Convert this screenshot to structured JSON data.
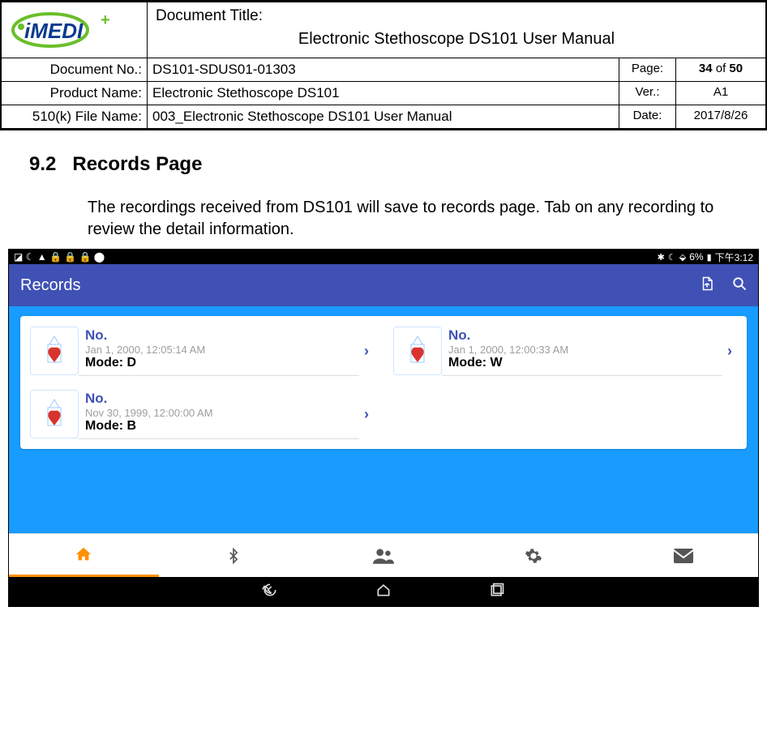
{
  "header": {
    "docTitleLabel": "Document Title:",
    "docTitle": "Electronic Stethoscope DS101 User Manual",
    "docNoLabel": "Document No.:",
    "docNo": "DS101-SDUS01-01303",
    "pageLabel": "Page:",
    "pageCurrent": "34",
    "pageOf": " of ",
    "pageTotal": "50",
    "productLabel": "Product Name:",
    "productName": "Electronic Stethoscope DS101",
    "verLabel": "Ver.:",
    "ver": "A1",
    "fileLabel": "510(k) File Name:",
    "fileName": "003_Electronic Stethoscope DS101 User Manual",
    "dateLabel": "Date:",
    "date": "2017/8/26"
  },
  "section": {
    "number": "9.2",
    "title": "Records Page",
    "body": "The recordings received from DS101 will save to records page. Tab on any recording to review the detail information."
  },
  "screenshot": {
    "statusbar": {
      "leftIcons": "◪ ☾ ▲ 🔒 🔒 🔒 ⬤",
      "battery": "6%",
      "time": "下午3:12"
    },
    "appbar": {
      "title": "Records"
    },
    "records": [
      {
        "no": "No.",
        "date": "Jan 1, 2000, 12:05:14 AM",
        "mode": "Mode: D"
      },
      {
        "no": "No.",
        "date": "Jan 1, 2000, 12:00:33 AM",
        "mode": "Mode: W"
      },
      {
        "no": "No.",
        "date": "Nov 30, 1999, 12:00:00 AM",
        "mode": "Mode: B"
      }
    ]
  }
}
